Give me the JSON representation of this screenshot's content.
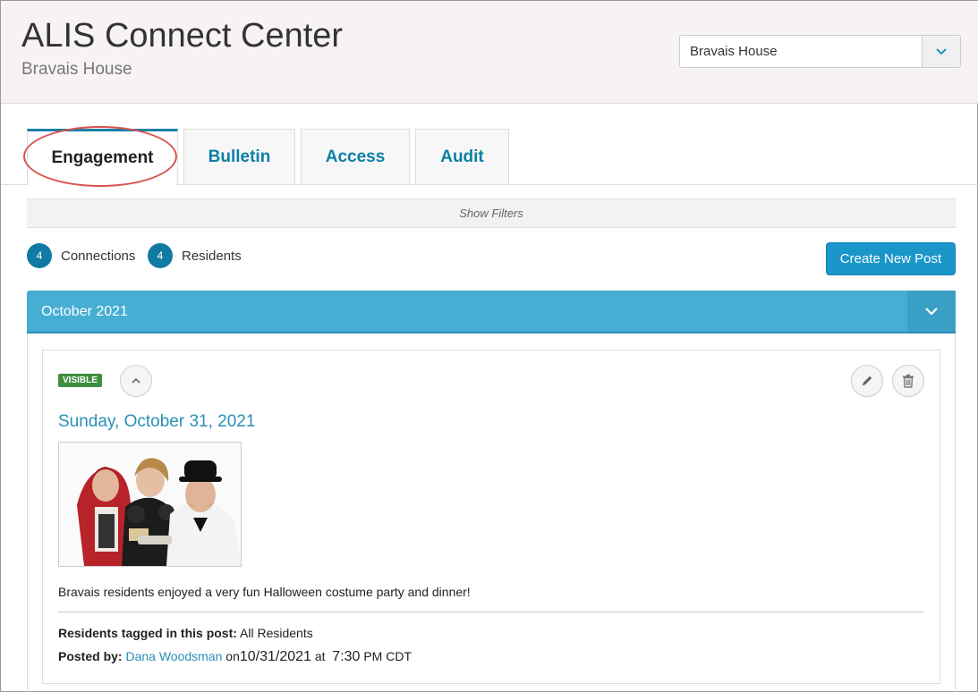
{
  "header": {
    "title": "ALIS Connect Center",
    "subtitle": "Bravais House",
    "community_select": {
      "value": "Bravais House"
    }
  },
  "tabs": [
    {
      "label": "Engagement",
      "active": true
    },
    {
      "label": "Bulletin",
      "active": false
    },
    {
      "label": "Access",
      "active": false
    },
    {
      "label": "Audit",
      "active": false
    }
  ],
  "filters": {
    "label": "Show Filters"
  },
  "stats": {
    "connections": {
      "count": "4",
      "label": "Connections"
    },
    "residents": {
      "count": "4",
      "label": "Residents"
    }
  },
  "actions": {
    "create_post_label": "Create New Post"
  },
  "month_group": {
    "title": "October 2021"
  },
  "post": {
    "badge": "VISIBLE",
    "date": "Sunday, October 31, 2021",
    "image_alt": "photo of three residents in Halloween costumes",
    "text": "Bravais residents enjoyed a very fun Halloween costume party and dinner!",
    "tagged_label": "Residents tagged in this post:",
    "tagged_value": "All Residents",
    "posted_by_label": "Posted by:",
    "author": "Dana Woodsman",
    "on_word": "on",
    "post_date": "10/31/2021",
    "at_word": "at",
    "time": "7:30",
    "tz": "PM CDT"
  },
  "colors": {
    "accent": "#1a96c9",
    "month_bar": "#46aed3",
    "badge_green": "#3f8f3f",
    "annotation_red": "#d9534f"
  },
  "icons": {
    "dropdown": "chevron-down-icon",
    "collapse_post": "chevron-up-icon",
    "edit": "pencil-icon",
    "delete": "trash-icon"
  }
}
